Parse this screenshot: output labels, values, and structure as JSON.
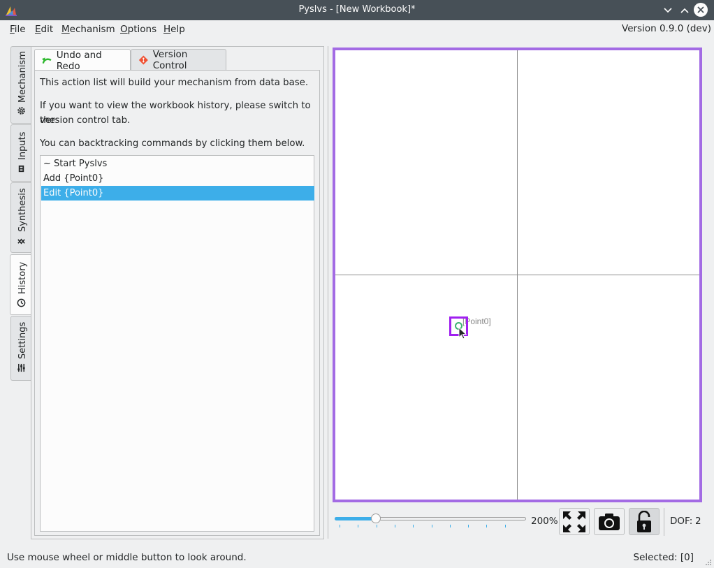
{
  "window": {
    "title": "Pyslvs - [New Workbook]*",
    "controls": [
      "chevron-down-icon",
      "chevron-up-icon",
      "close-icon"
    ]
  },
  "menubar": {
    "items": [
      {
        "label": "File",
        "u": "F",
        "rest": "ile"
      },
      {
        "label": "Edit",
        "u": "E",
        "rest": "dit"
      },
      {
        "label": "Mechanism",
        "u": "M",
        "rest": "echanism"
      },
      {
        "label": "Options",
        "u": "O",
        "rest": "ptions"
      },
      {
        "label": "Help",
        "u": "H",
        "rest": "elp"
      }
    ],
    "version": "Version 0.9.0 (dev)"
  },
  "side_tabs": [
    {
      "label": "Mechanism",
      "icon": "gear-icon"
    },
    {
      "label": "Inputs",
      "icon": "pen-icon"
    },
    {
      "label": "Synthesis",
      "icon": "linkage-icon"
    },
    {
      "label": "History",
      "icon": "clock-icon",
      "active": true
    },
    {
      "label": "Settings",
      "icon": "sliders-icon"
    }
  ],
  "tabs": [
    {
      "label": "Undo and Redo",
      "icon": "undo-icon",
      "active": true
    },
    {
      "label": "Version Control",
      "icon": "git-icon"
    }
  ],
  "history": {
    "intro": "This action list will build your mechanism from data base.",
    "info_line1": "If you want to view the workbook history, please switch to the",
    "info_line2": "version control tab.",
    "hint": "You can backtracking commands by clicking them below.",
    "items": [
      {
        "label": "~ Start Pyslvs"
      },
      {
        "label": "Add {Point0}"
      },
      {
        "label": "Edit {Point0}",
        "selected": true
      }
    ]
  },
  "canvas": {
    "border_color": "#a36be4",
    "point_label": "[Point0]",
    "point_color": "#a020f0",
    "point_dot_color": "#3cb371"
  },
  "zoom": {
    "value": 200,
    "label": "200%",
    "fraction": 0.2
  },
  "toolbar": {
    "buttons": [
      "fit-screen-icon",
      "camera-icon",
      "unlock-icon"
    ]
  },
  "dof": {
    "label": "DOF:",
    "value": "2"
  },
  "status": {
    "message": "Use mouse wheel or middle button to look around.",
    "selected": "Selected: [0]"
  },
  "colors": {
    "accent": "#3daee9",
    "titlebar": "#475057",
    "background": "#eff0f1"
  }
}
